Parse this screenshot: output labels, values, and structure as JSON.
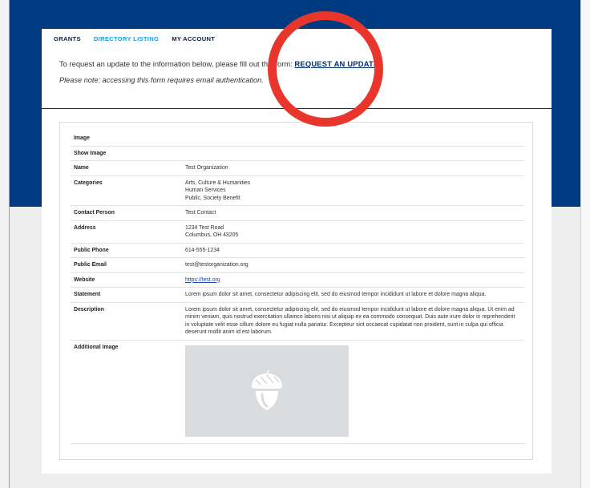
{
  "nav": {
    "grants": "GRANTS",
    "directory": "DIRECTORY LISTING",
    "account": "MY ACCOUNT"
  },
  "notice": {
    "prefix": "To request an update to the information below, please fill out this form: ",
    "cta": "REQUEST AN UPDATE",
    "suffix": ".",
    "note": "Please note: accessing this form requires email authentication."
  },
  "fields": {
    "image": {
      "label": "Image"
    },
    "show_image": {
      "label": "Show Image"
    },
    "name": {
      "label": "Name",
      "value": "Test Organization"
    },
    "categories": {
      "label": "Categories",
      "values": [
        "Arts, Culture & Humanities",
        "Human Services",
        "Public, Society Benefit"
      ]
    },
    "contact": {
      "label": "Contact Person",
      "value": "Test Contact"
    },
    "address": {
      "label": "Address",
      "line1": "1234 Test Road",
      "line2": "Columbus, OH 43205"
    },
    "phone": {
      "label": "Public Phone",
      "value": "614-555-1234"
    },
    "email": {
      "label": "Public Email",
      "value": "test@testorganization.org"
    },
    "website": {
      "label": "Website",
      "value": "https://test.org"
    },
    "statement": {
      "label": "Statement",
      "value": "Lorem ipsum dolor sit amet, consectetur adipiscing elit, sed do eiusmod tempor incididunt ut labore et dolore magna aliqua."
    },
    "description": {
      "label": "Description",
      "value": "Lorem ipsum dolor sit amet, consectetur adipiscing elit, sed do eiusmod tempor incididunt ut labore et dolore magna aliqua. Ut enim ad minim veniam, quis nostrud exercitation ullamco laboris nisi ut aliquip ex ea commodo consequat. Duis aute irure dolor in reprehenderit in voluptate velit esse cillum dolore eu fugiat nulla pariatur. Excepteur sint occaecat cupidatat non proident, sunt in culpa qui officia deserunt mollit anim id est laborum."
    },
    "additional_image": {
      "label": "Additional Image",
      "icon": "acorn-icon"
    }
  },
  "colors": {
    "header_blue": "#003a80",
    "active_nav": "#1aa0e8",
    "annotation_red": "#e8362c"
  }
}
